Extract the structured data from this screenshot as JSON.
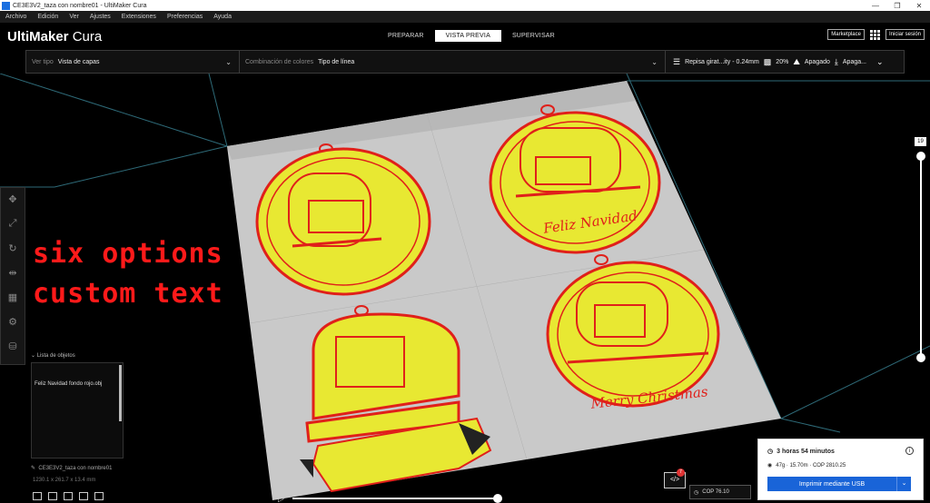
{
  "window": {
    "title": "CE3E3V2_taza con nombre01 - UltiMaker Cura",
    "controls": [
      "—",
      "❐",
      "✕"
    ]
  },
  "menu": [
    "Archivo",
    "Edición",
    "Ver",
    "Ajustes",
    "Extensiones",
    "Preferencias",
    "Ayuda"
  ],
  "header": {
    "brand_bold": "UltiMaker",
    "brand_light": " Cura",
    "stages": [
      "PREPARAR",
      "VISTA PREVIA",
      "SUPERVISAR"
    ],
    "active_stage": "VISTA PREVIA",
    "marketplace": "Marketplace",
    "signin": "Iniciar sesión"
  },
  "toolbar": {
    "view_type_label": "Ver tipo",
    "view_type_value": "Vista de capas",
    "color_scheme_label": "Combinación de colores",
    "color_scheme_value": "Tipo de línea",
    "profile": "Repisa girat...ity - 0.24mm",
    "infill": "20%",
    "support": "Apagado",
    "adhesion": "Apaga..."
  },
  "overlay": {
    "line1": "six options",
    "line2": "custom text"
  },
  "ornaments": {
    "top_right_text": "Feliz Navidad",
    "bottom_right_text": "Merry Christmas"
  },
  "object_list": {
    "title": "Lista de objetos",
    "items": [
      "",
      "",
      "Feliz Navidad fondo rojo.obj",
      "",
      "",
      ""
    ],
    "selected_index": 2,
    "object_name": "CE3E3V2_taza con nombre01",
    "dimensions": "1230.1 x 261.7 x 13.4 mm"
  },
  "layer_slider": {
    "current_layer": "19",
    "top_fraction": 1.0,
    "bottom_fraction": 0.0
  },
  "playback": {
    "progress_fraction": 1.0
  },
  "print": {
    "badge_count": "7",
    "code_label": "</>",
    "cop_label": "COP 76.10",
    "time": "3 horas 54 minutos",
    "material": "47g · 15.70m · COP 2810.25",
    "button": "Imprimir mediante USB"
  },
  "colors": {
    "accent": "#1964d8",
    "shell_red": "#e0201a",
    "infill_yellow": "#e8e832",
    "build_plate": "#c9c9c9",
    "overlay_text": "#ff1a1a"
  }
}
